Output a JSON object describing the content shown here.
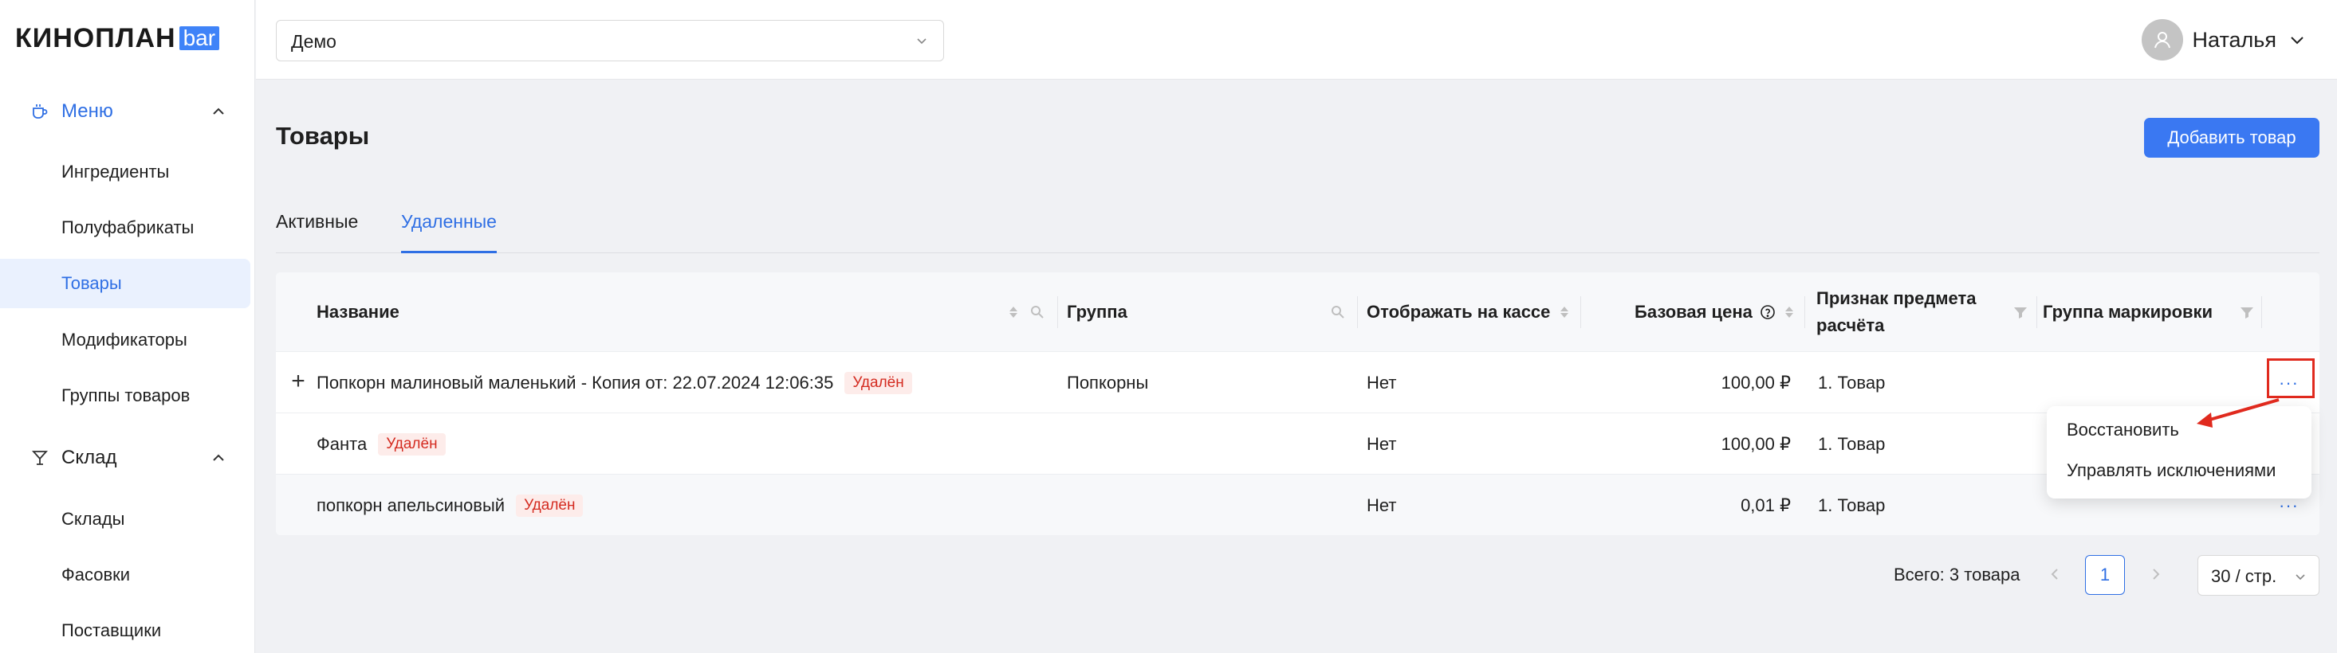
{
  "brand": {
    "logo_text": "КИНОПЛАН",
    "logo_badge": "bar",
    "accent": "#3a78f2"
  },
  "sidebar": {
    "sections": [
      {
        "label": "Меню",
        "icon": "cup-icon",
        "expanded": true
      },
      {
        "label": "Склад",
        "icon": "glass-icon",
        "expanded": true
      }
    ],
    "menu_items": [
      "Ингредиенты",
      "Полуфабрикаты",
      "Товары",
      "Модификаторы",
      "Группы товаров"
    ],
    "warehouse_items": [
      "Склады",
      "Фасовки",
      "Поставщики"
    ],
    "selected": "Товары"
  },
  "topbar": {
    "cinema_select": "Демо",
    "user_name": "Наталья"
  },
  "page": {
    "title": "Товары",
    "add_button": "Добавить товар",
    "tabs": [
      {
        "label": "Активные",
        "active": false
      },
      {
        "label": "Удаленные",
        "active": true
      }
    ]
  },
  "table": {
    "columns": {
      "name": "Название",
      "group": "Группа",
      "show_at_cashier": "Отображать на кассе",
      "base_price": "Базовая цена",
      "subject_line1": "Признак предмета",
      "subject_line2": "расчёта",
      "marking_group": "Группа маркировки"
    },
    "rows": [
      {
        "name": "Попкорн малиновый маленький - Копия от: 22.07.2024 12:06:35",
        "badge": "Удалён",
        "group": "Попкорны",
        "show": "Нет",
        "price": "100,00 ₽",
        "subject": "1. Товар",
        "marking": "",
        "actions": "···",
        "expandable": true
      },
      {
        "name": "Фанта",
        "badge": "Удалён",
        "group": "",
        "show": "Нет",
        "price": "100,00 ₽",
        "subject": "1. Товар",
        "marking": "",
        "actions": "···",
        "expandable": false
      },
      {
        "name": "попкорн апельсиновый",
        "badge": "Удалён",
        "group": "",
        "show": "Нет",
        "price": "0,01 ₽",
        "subject": "1. Товар",
        "marking": "",
        "actions": "···",
        "expandable": false
      }
    ]
  },
  "row_menu": {
    "items": [
      "Восстановить",
      "Управлять исключениями"
    ]
  },
  "pagination": {
    "total": "Всего: 3 товара",
    "current_page": "1",
    "page_size": "30 / стр."
  },
  "annotation": {
    "color": "#e02a1e"
  }
}
